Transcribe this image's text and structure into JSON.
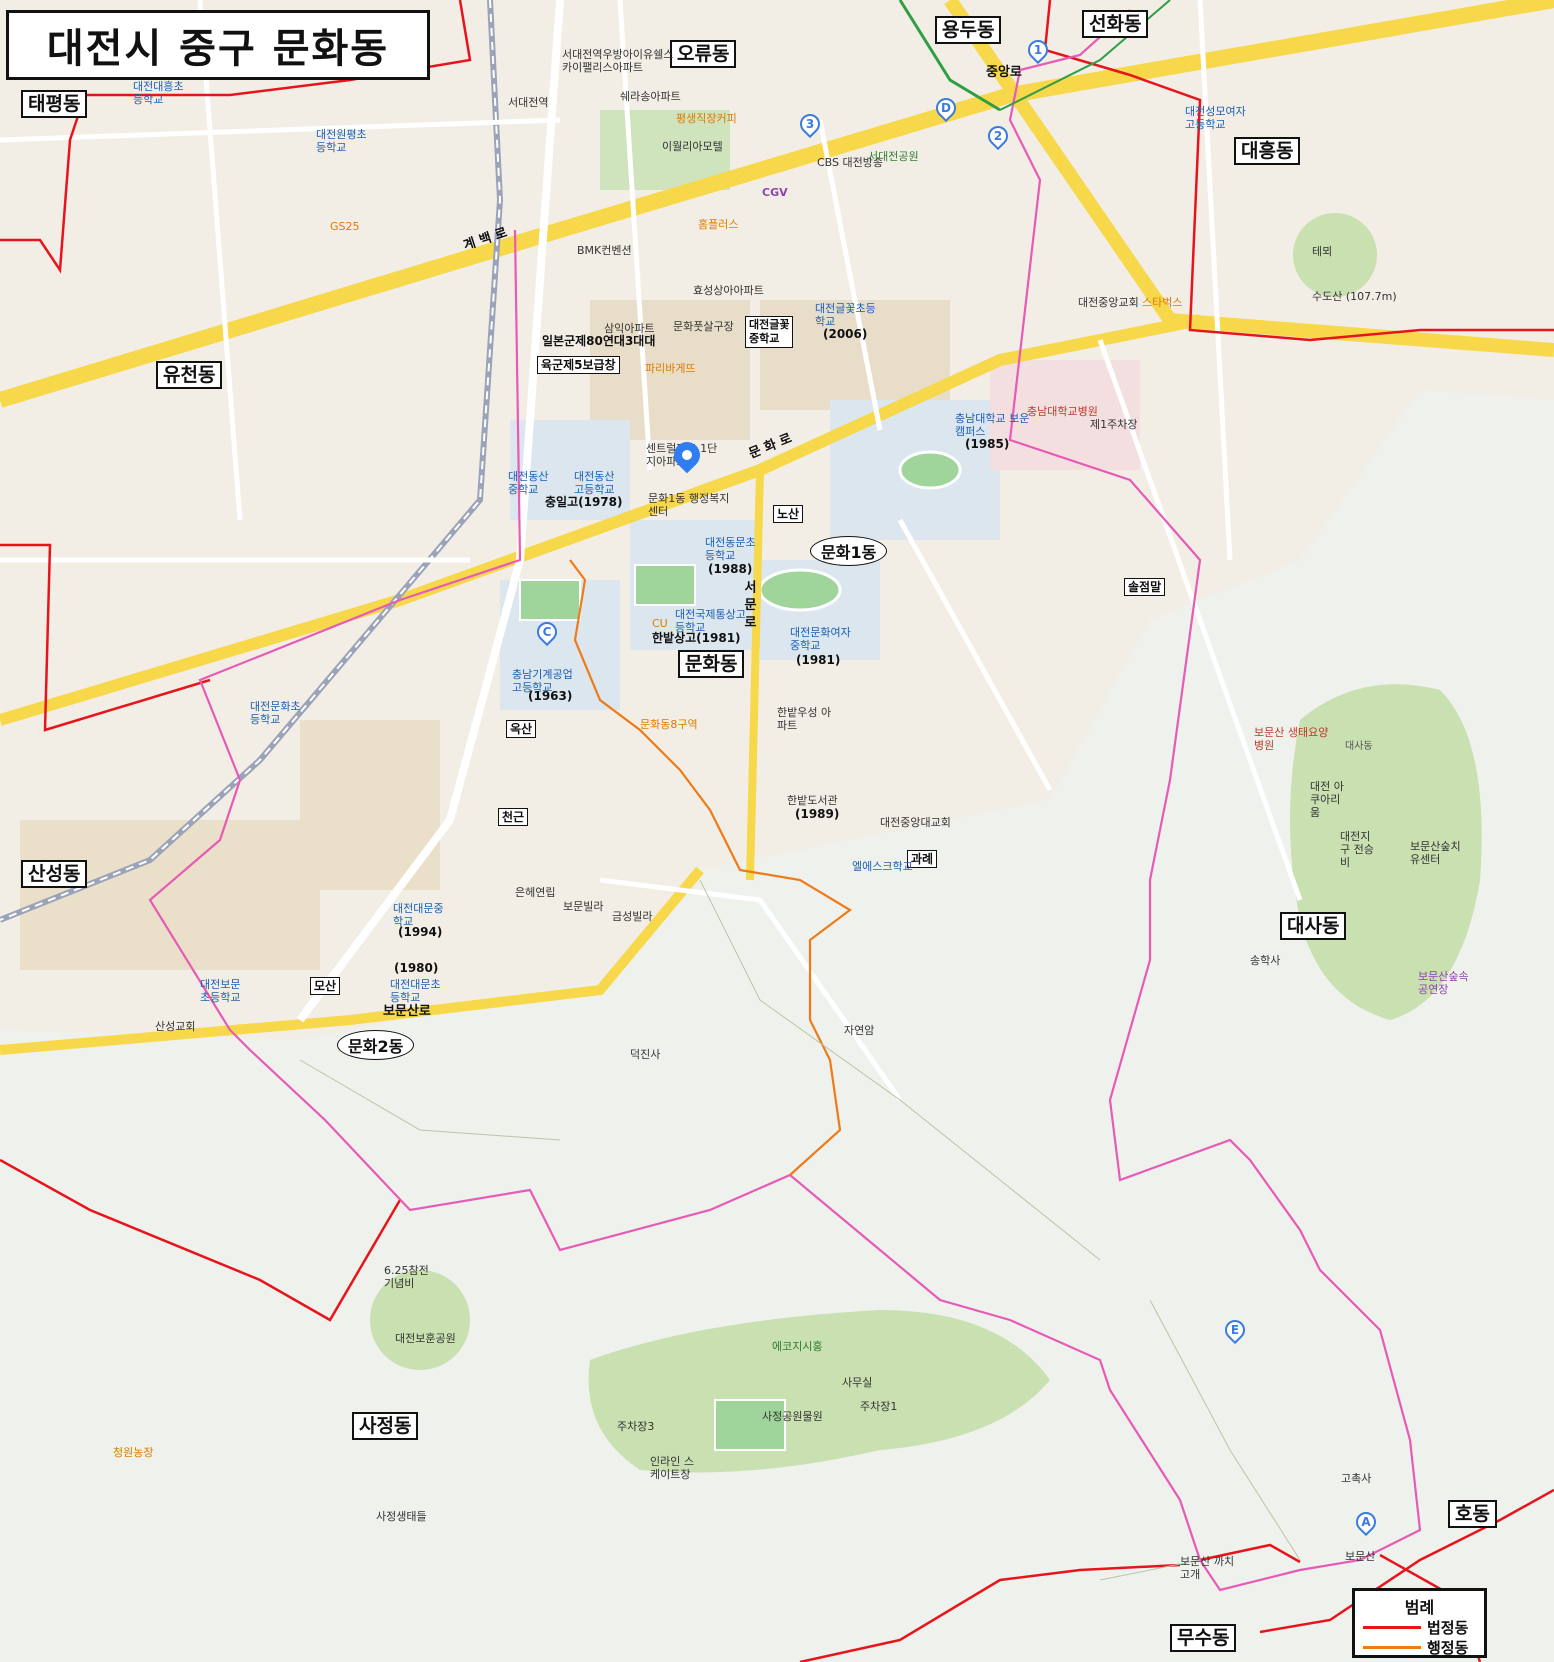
{
  "title": "대전시 중구 문화동",
  "districts": {
    "munhwa": "문화동",
    "taepyeong": "태평동",
    "yucheon": "유천동",
    "sanseong": "산성동",
    "oryu": "오류동",
    "yongdu": "용두동",
    "seonhwa": "선화동",
    "daeheung": "대흥동",
    "daesa": "대사동",
    "sajeong": "사정동",
    "ho": "호동",
    "musu": "무수동"
  },
  "admin_ovals": {
    "munhwa1": "문화1동",
    "munhwa2": "문화2동"
  },
  "landmarks": {
    "eulji": "일본군제80연대3대대",
    "yukgun": "육군제5보급창",
    "school_box": "대전글꽃\n중학교",
    "nosan": "노산",
    "oksan": "옥산",
    "cheongeun": "천근",
    "gwarae": "과례",
    "mosan": "모산",
    "soljeommal": "솔점말"
  },
  "roads": {
    "gyebaek": "계 백 로",
    "munhwa_ro": "문 화 로",
    "boeunsan_ro": "보문산로",
    "jungang_ro": "중앙로",
    "seomun_ro": "서 문 로"
  },
  "places": [
    "서대전역우방아이유쉘스카이팰리스아파트",
    "서대전역",
    "쉐라송아파트",
    "평생직장커피",
    "이월리아모텔",
    "CBS 대전방송",
    "CGV",
    "서대전공원",
    "홈플러스",
    "BMK컨벤션",
    "효성상아아파트",
    "삼익아파트",
    "문화풋살구장",
    "파리바게뜨",
    "센트럴파크 1단지아파트",
    "문화1동 행정복지센터",
    "대전동산중학교",
    "대전동산고등학교",
    "충일고(1978)",
    "대전동문초등학교",
    "(1988)",
    "대전국제통상고등학교",
    "한밭상고(1981)",
    "대전문화여자중학교",
    "(1981)",
    "한밭도서관",
    "(1989)",
    "충남대학교 보운캠퍼스",
    "(1985)",
    "충남대학교병원",
    "대전글꽃초등학교",
    "(2006)",
    "충남기계공업고등학교",
    "(1963)",
    "대전대문중학교",
    "(1994)",
    "대전대문초등학교",
    "(1980)",
    "대전보문초등학교",
    "대전문화초등학교",
    "엘에스크학교",
    "보문산 생태요양병원",
    "보문산숲치유센터",
    "보문산숲속공연장",
    "에코지시홍",
    "사무실",
    "사정공원물원",
    "인라인 스케이트장",
    "6.25참전 기념비",
    "대전보훈공원",
    "사정생태들",
    "청원농장",
    "보문산 까치고개",
    "고촉사",
    "송학사",
    "자연암",
    "덕진사",
    "은헤연립",
    "보문빌라",
    "금성빌라",
    "한밭우성 아파트",
    "산성교회",
    "대전원평초등학교",
    "대전대흥초등학교",
    "대전성모여자고등학교",
    "대전중앙교회",
    "스타벅스",
    "GS25",
    "CU",
    "제1주차장",
    "주차장1",
    "주차장3",
    "문화동8구역",
    "대전중앙대교회",
    "수도산 (107.7m)",
    "테뫼",
    "대전지구 전승비",
    "대전 아쿠아리움",
    "대사동",
    "보문산"
  ],
  "map_pins": [
    "1",
    "2",
    "3",
    "D",
    "C",
    "E",
    "A"
  ],
  "legend": {
    "title": "범례",
    "legal": "법정동",
    "admin": "행정동"
  },
  "colors": {
    "legal_boundary": "#e8141c",
    "admin_boundary": "#e75ab6",
    "sub_boundary": "#ef7a18",
    "road_major": "#f6d84a",
    "park": "#cbe3b5",
    "urban": "#efe9dc",
    "school": "#d9e5ef"
  },
  "icons": [
    "pin-icon",
    "park-icon",
    "temple-icon",
    "parking-icon",
    "school-icon"
  ]
}
